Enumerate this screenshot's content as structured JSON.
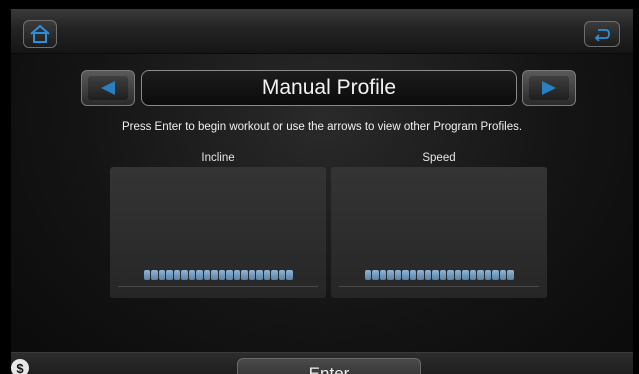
{
  "header": {
    "home_icon": "home-icon",
    "back_icon": "return-icon"
  },
  "profile": {
    "title": "Manual Profile",
    "prev_icon": "arrow-left-icon",
    "next_icon": "arrow-right-icon"
  },
  "instruction": "Press Enter to begin workout or use the arrows to view other Program Profiles.",
  "panels": [
    {
      "label": "Incline",
      "segments": 20
    },
    {
      "label": "Speed",
      "segments": 20
    }
  ],
  "footer": {
    "enter_label": "Enter",
    "help_glyph": "$",
    "help_icon": "help-icon"
  },
  "colors": {
    "accent_blue": "#2a7fc0",
    "bar_blue": "#7ea6c9"
  }
}
